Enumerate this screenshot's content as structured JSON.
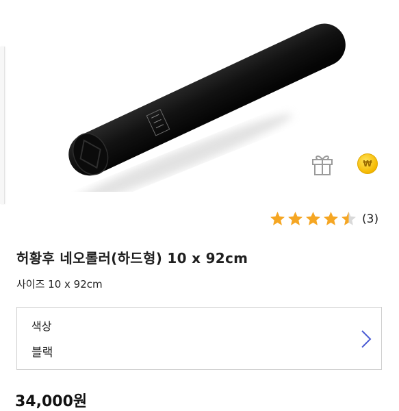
{
  "product": {
    "title": "허황후 네오롤러(하드형) 10 x 92cm",
    "size_line": "사이즈 10 x 92cm",
    "price": "34,000원"
  },
  "icons": {
    "gift": "gift-icon",
    "coin": "won-coin-icon",
    "coin_glyph": "₩",
    "chevron": "chevron-right-icon"
  },
  "rating": {
    "value": 4.5,
    "max": 5,
    "count_label": "(3)",
    "star_color": "#f5a623",
    "empty_color": "#d9d9d9"
  },
  "option": {
    "label": "색상",
    "value": "블랙"
  },
  "colors": {
    "accent": "#4a5bd4",
    "coin": "#f5b800"
  }
}
